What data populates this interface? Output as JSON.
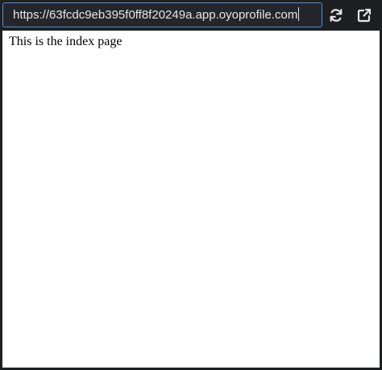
{
  "toolbar": {
    "url": "https://63fcdc9eb395f0ff8f20249a.app.oyoprofile.com",
    "refresh_icon": "refresh-icon",
    "open_external_icon": "external-link-icon"
  },
  "content": {
    "text": "This is the index page"
  },
  "colors": {
    "toolbar_background": "#1e1f23",
    "url_border": "#4a90d9",
    "page_background": "#ffffff"
  }
}
